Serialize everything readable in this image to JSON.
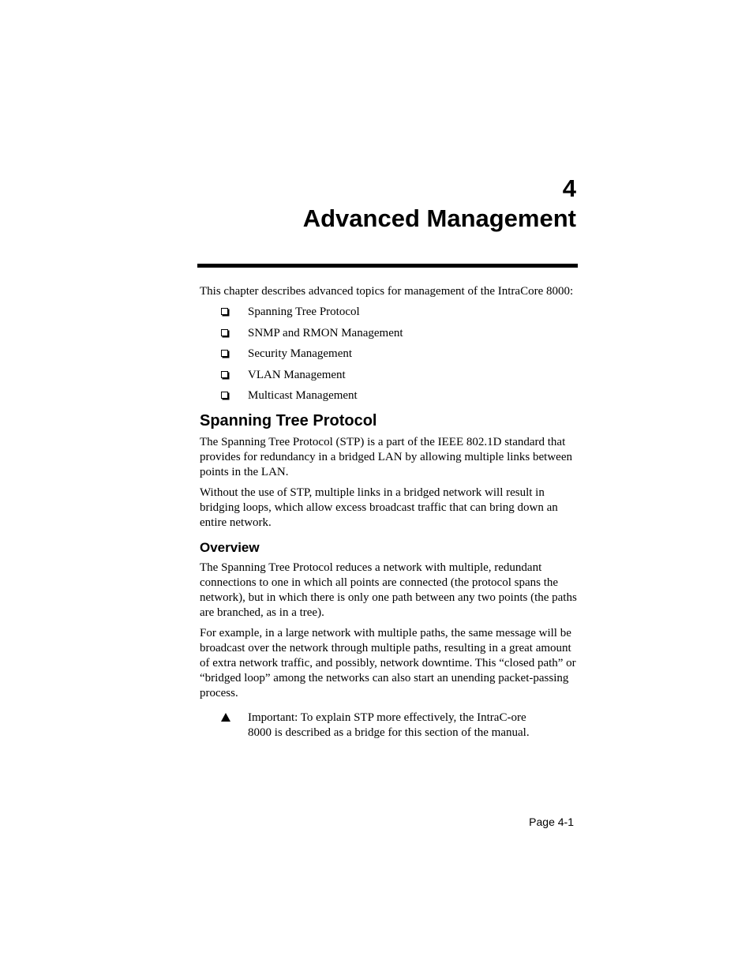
{
  "chapter": {
    "number": "4",
    "title": "Advanced Management"
  },
  "intro": "This chapter describes advanced topics for management of the IntraCore 8000:",
  "topics": [
    {
      "label": "Spanning Tree Protocol",
      "icon": "box-bullet-icon"
    },
    {
      "label": "SNMP and RMON Management",
      "icon": "box-bullet-icon"
    },
    {
      "label": "Security Management",
      "icon": "box-bullet-icon"
    },
    {
      "label": "VLAN Management",
      "icon": "box-bullet-icon"
    },
    {
      "label": "Multicast Management",
      "icon": "box-bullet-icon"
    }
  ],
  "section": {
    "heading": "Spanning Tree Protocol",
    "paragraphs": [
      "The Spanning Tree Protocol (STP) is a part of the IEEE 802.1D standard that provides for redundancy in a bridged LAN by allowing multiple links between points in the LAN.",
      "Without the use of STP, multiple links in a bridged network will result in bridging loops, which allow excess broadcast traffic that can bring down an entire network."
    ],
    "subsection": {
      "heading": "Overview",
      "paragraphs": [
        "The Spanning Tree Protocol reduces a network with multiple, redundant connections to one in which all points are connected (the protocol spans the network), but in which there is only one path between any two points (the paths are branched, as in a tree).",
        "For example, in a large network with multiple paths, the same message will be broadcast over the network through multiple paths, resulting in a great amount of extra network traffic, and possibly, network downtime. This “closed path” or “bridged loop” among the networks can also start an unending packet-passing process."
      ],
      "note": {
        "icon": "triangle-icon",
        "text": "Important: To explain STP more effectively, the IntraC-ore 8000 is described as a bridge for this section of the manual."
      }
    }
  },
  "footer": {
    "page_label": "Page 4-1"
  }
}
